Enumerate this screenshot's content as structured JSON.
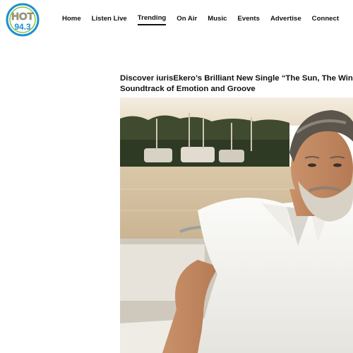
{
  "brand": {
    "logo_text_top": "HOT",
    "logo_text_bottom": "94.3",
    "colors": {
      "primary_blue": "#1f8fd0",
      "accent_orange": "#f28a1e",
      "accent_green": "#8cc63f"
    }
  },
  "nav": {
    "items": [
      {
        "label": "Home"
      },
      {
        "label": "Listen Live"
      },
      {
        "label": "Trending",
        "active": true
      },
      {
        "label": "On Air"
      },
      {
        "label": "Music"
      },
      {
        "label": "Events"
      },
      {
        "label": "Advertise"
      },
      {
        "label": "Connect"
      }
    ]
  },
  "article": {
    "title_line1": "Discover iurisEkero’s Brilliant New Single “The Sun, The Wine and",
    "title_line2": "Soundtrack of Emotion and Groove",
    "hero_image": "man-in-white-shirt-on-boat-photo"
  }
}
